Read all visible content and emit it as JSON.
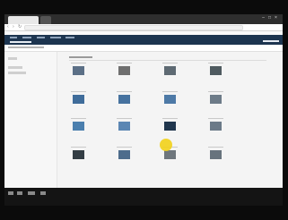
{
  "browser": {
    "tabs": [
      "",
      ""
    ],
    "url": ""
  },
  "app": {
    "brand": "",
    "user": "",
    "breadcrumb": ""
  },
  "gallery": {
    "title": "",
    "thumbnails": [
      {
        "color": "#5b6f86"
      },
      {
        "color": "#6f6f6f"
      },
      {
        "color": "#5e6a73"
      },
      {
        "color": "#4f5b60"
      },
      {
        "color": "#3f6c9a"
      },
      {
        "color": "#46729f"
      },
      {
        "color": "#4d79a6"
      },
      {
        "color": "#6d7b88"
      },
      {
        "color": "#4b7fae"
      },
      {
        "color": "#5b86b3"
      },
      {
        "color": "#20364d"
      },
      {
        "color": "#6b7a88"
      },
      {
        "color": "#333d44"
      },
      {
        "color": "#4d6c8c"
      },
      {
        "color": "#6e767c"
      },
      {
        "color": "#67737d"
      }
    ]
  },
  "colors": {
    "app_header": "#1d3550",
    "page_background": "#f4f4f4",
    "letterbox": "#0b0b0b",
    "cursor_highlight": "#f2d11a"
  },
  "icons": [
    "back-icon",
    "forward-icon",
    "reload-icon",
    "minimize-icon",
    "maximize-icon",
    "close-icon"
  ]
}
